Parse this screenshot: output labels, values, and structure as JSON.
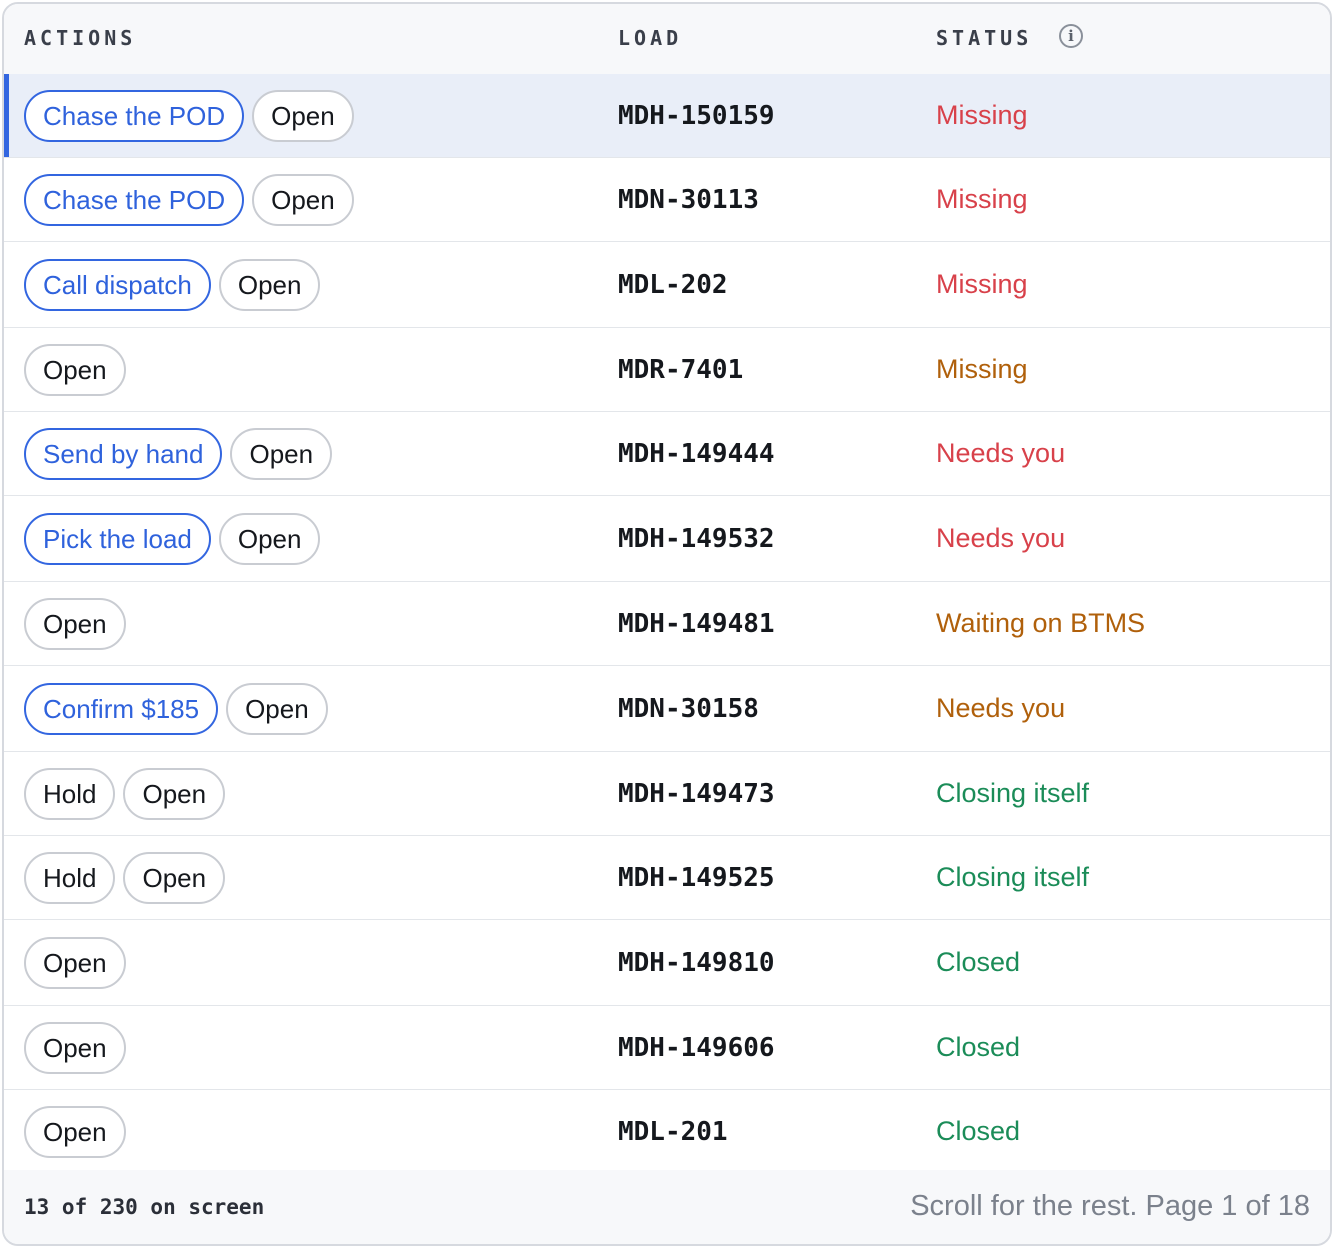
{
  "table": {
    "columns": {
      "actions": "ACTIONS",
      "load": "LOAD",
      "status": "STATUS"
    },
    "info_icon": "info-icon",
    "rows": [
      {
        "actions": [
          "Chase the POD",
          "Open"
        ],
        "load": "MDH-150159",
        "status": "Missing",
        "status_tone": "red",
        "selected": true
      },
      {
        "actions": [
          "Chase the POD",
          "Open"
        ],
        "load": "MDN-30113",
        "status": "Missing",
        "status_tone": "red"
      },
      {
        "actions": [
          "Call dispatch",
          "Open"
        ],
        "load": "MDL-202",
        "status": "Missing",
        "status_tone": "red"
      },
      {
        "actions": [
          "Open"
        ],
        "load": "MDR-7401",
        "status": "Missing",
        "status_tone": "amber"
      },
      {
        "actions": [
          "Send by hand",
          "Open"
        ],
        "load": "MDH-149444",
        "status": "Needs you",
        "status_tone": "red"
      },
      {
        "actions": [
          "Pick the load",
          "Open"
        ],
        "load": "MDH-149532",
        "status": "Needs you",
        "status_tone": "red"
      },
      {
        "actions": [
          "Open"
        ],
        "load": "MDH-149481",
        "status": "Waiting on BTMS",
        "status_tone": "amber"
      },
      {
        "actions": [
          "Confirm $185",
          "Open"
        ],
        "load": "MDN-30158",
        "status": "Needs you",
        "status_tone": "amber"
      },
      {
        "actions": [
          "Hold",
          "Open"
        ],
        "load": "MDH-149473",
        "status": "Closing itself",
        "status_tone": "green"
      },
      {
        "actions": [
          "Hold",
          "Open"
        ],
        "load": "MDH-149525",
        "status": "Closing itself",
        "status_tone": "green"
      },
      {
        "actions": [
          "Open"
        ],
        "load": "MDH-149810",
        "status": "Closed",
        "status_tone": "green"
      },
      {
        "actions": [
          "Open"
        ],
        "load": "MDH-149606",
        "status": "Closed",
        "status_tone": "green"
      },
      {
        "actions": [
          "Open"
        ],
        "load": "MDL-201",
        "status": "Closed",
        "status_tone": "green"
      }
    ]
  },
  "footer": {
    "count": "13 of 230 on screen",
    "hint": "Scroll for the rest. Page 1 of 18"
  },
  "colors": {
    "primary": "#3366e0",
    "status_red": "#d8414a",
    "status_amber": "#b0600b",
    "status_green": "#1b8c58"
  }
}
